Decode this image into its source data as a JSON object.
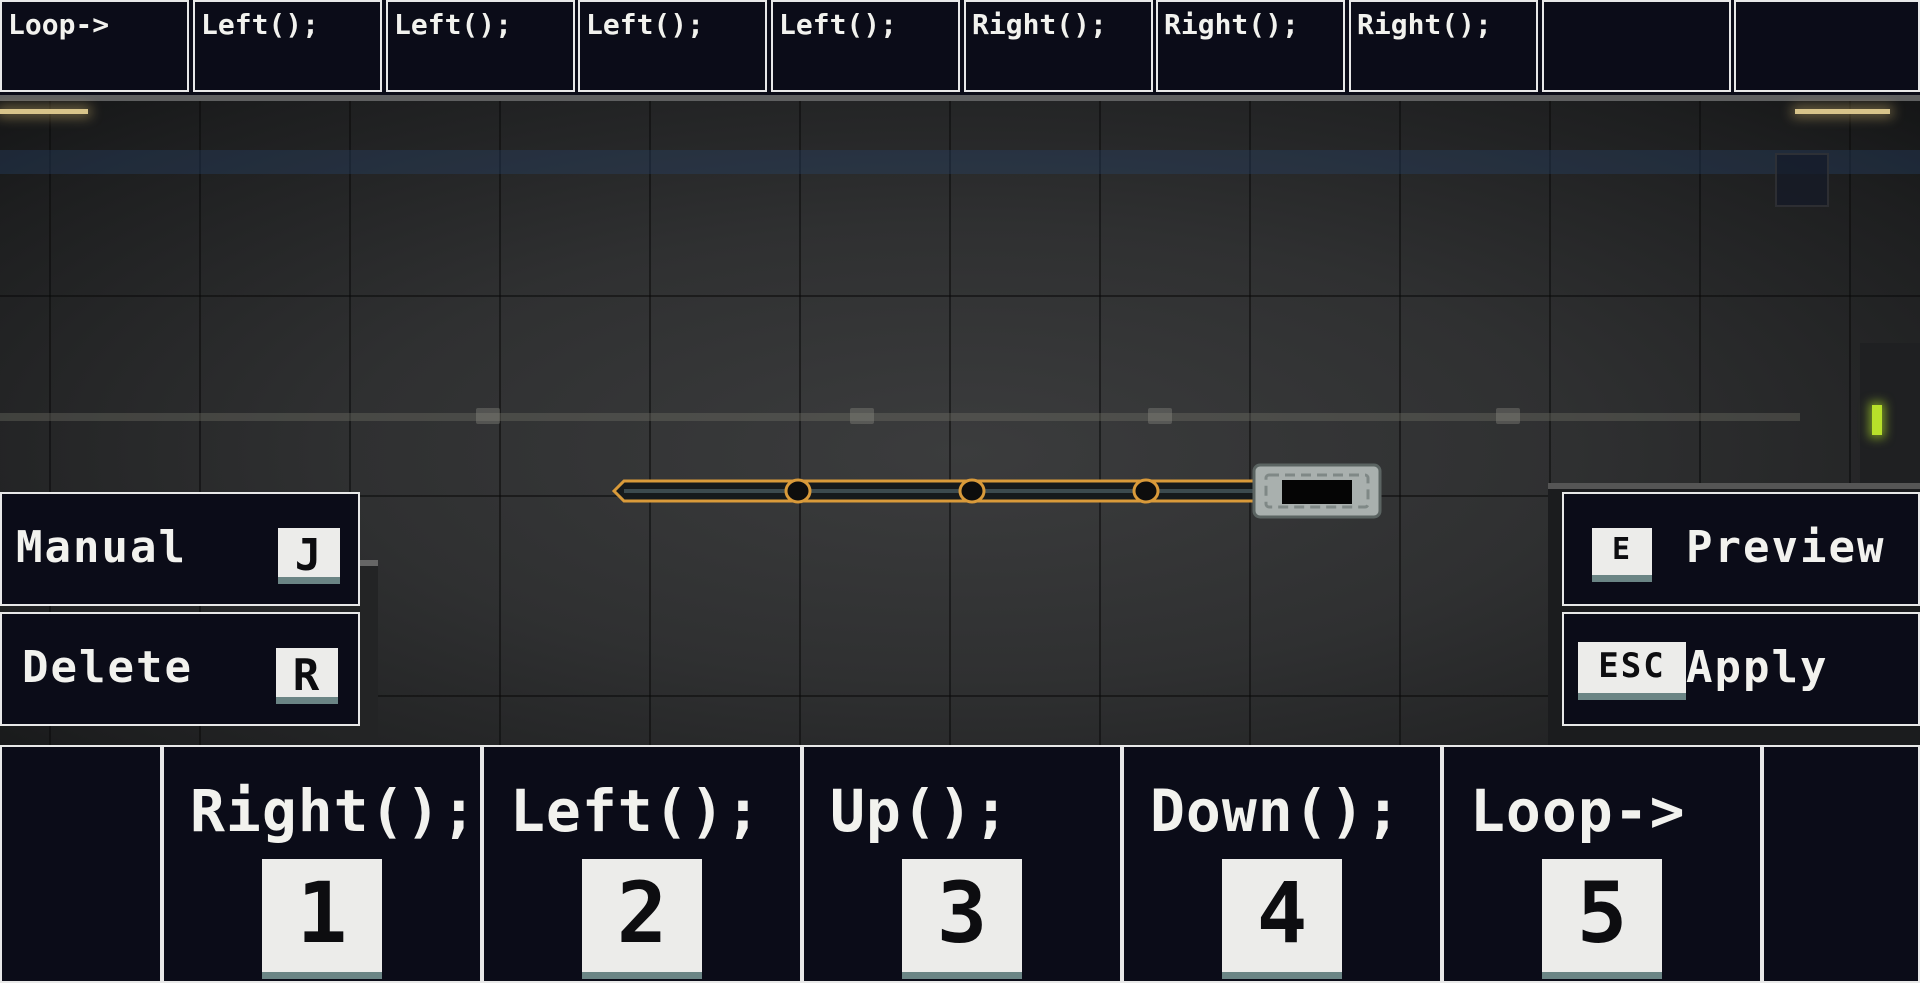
{
  "top_sequence": [
    "Loop->",
    "Left();",
    "Left();",
    "Left();",
    "Left();",
    "Right();",
    "Right();",
    "Right();",
    "",
    ""
  ],
  "left_panel": {
    "manual": {
      "label": "Manual",
      "key": "J"
    },
    "delete": {
      "label": "Delete",
      "key": "R"
    }
  },
  "right_panel": {
    "preview": {
      "label": "Preview",
      "key": "E"
    },
    "apply": {
      "label": "Apply",
      "key": "ESC"
    }
  },
  "command_palette": [
    {
      "label": "Right();",
      "key": "1"
    },
    {
      "label": "Left();",
      "key": "2"
    },
    {
      "label": "Up();",
      "key": "3"
    },
    {
      "label": "Down();",
      "key": "4"
    },
    {
      "label": "Loop->",
      "key": "5"
    }
  ],
  "colors": {
    "ui_background": "#0b0c18",
    "ui_border": "#e8e8e8",
    "keycap": "#ececea",
    "laser_outline": "#d99a3a",
    "indicator_light": "#b8e02a"
  }
}
